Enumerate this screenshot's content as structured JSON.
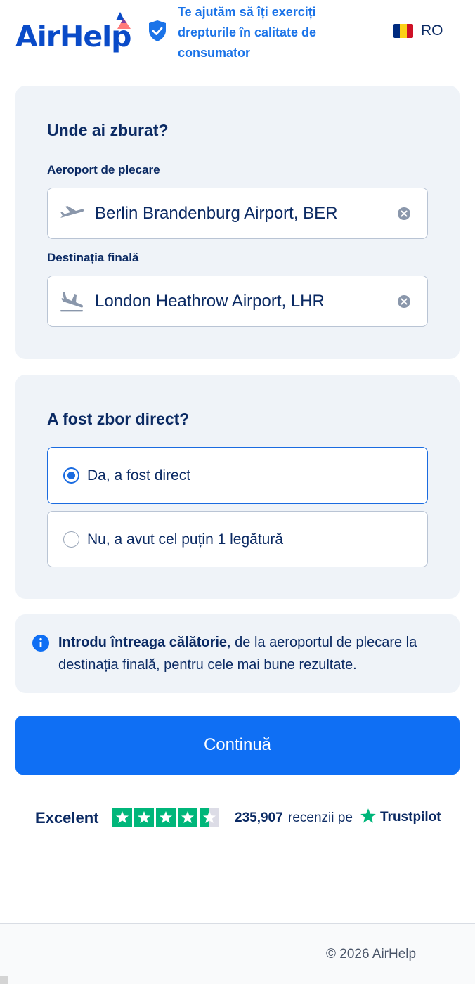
{
  "header": {
    "logo_text": "AirHelp",
    "tagline": "Te ajutăm să îți exerciți drepturile în calitate de consumator",
    "language": "RO",
    "flag_colors": [
      "#002b7f",
      "#fcd116",
      "#ce1126"
    ]
  },
  "route": {
    "title": "Unde ai zburat?",
    "departure_label": "Aeroport de plecare",
    "departure_value": "Berlin Brandenburg Airport, BER",
    "destination_label": "Destinația finală",
    "destination_value": "London Heathrow Airport, LHR",
    "departure_icon": "plane-takeoff-icon",
    "destination_icon": "plane-landing-icon",
    "clear_icon": "clear-icon"
  },
  "direct": {
    "title": "A fost zbor direct?",
    "options": [
      {
        "label": "Da, a fost direct",
        "selected": true
      },
      {
        "label": "Nu, a avut cel puțin 1 legătură",
        "selected": false
      }
    ]
  },
  "info": {
    "bold": "Introdu întreaga călătorie",
    "rest": ", de la aeroportul de plecare la destinația finală, pentru cele mai bune rezultate."
  },
  "cta": {
    "label": "Continuă"
  },
  "trustpilot": {
    "rating_word": "Excelent",
    "stars": 4.5,
    "count": "235,907",
    "reviews_text": "recenzii pe",
    "brand": "Trustpilot"
  },
  "footer": {
    "copyright": "© 2026 AirHelp"
  },
  "colors": {
    "brand_blue": "#0a4bc8",
    "accent": "#0f6ff4",
    "card_bg": "#eff3f8",
    "trustpilot_green": "#00b67a"
  }
}
